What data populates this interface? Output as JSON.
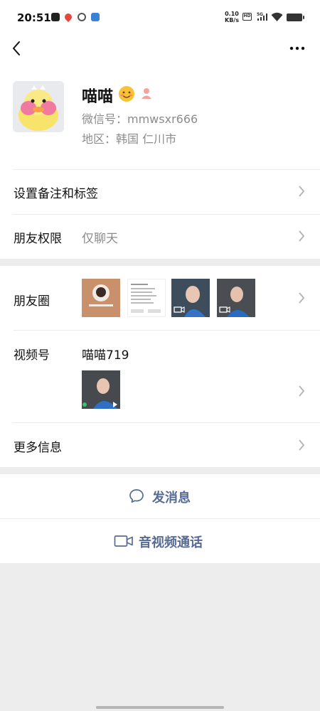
{
  "status_bar": {
    "time": "20:51",
    "net_speed_value": "0.10",
    "net_speed_unit": "KB/s",
    "hd": "HD",
    "signal": "5G"
  },
  "nav": {
    "back_icon": "chevron-left-icon",
    "more_icon": "more-dots-icon"
  },
  "profile": {
    "name": "喵喵",
    "wechat_id": "微信号：mmwsxr666",
    "region": "地区：韩国  仁川市"
  },
  "rows": {
    "remark": {
      "label": "设置备注和标签"
    },
    "permission": {
      "label": "朋友权限",
      "value": "仅聊天"
    },
    "moments": {
      "label": "朋友圈",
      "thumbs": 4
    },
    "channels": {
      "label": "视频号",
      "name": "喵喵719"
    },
    "more_info": {
      "label": "更多信息"
    }
  },
  "actions": {
    "message": "发消息",
    "call": "音视频通话"
  },
  "colors": {
    "accent": "#576b95",
    "background": "#ededed",
    "secondary_text": "#8c8c8c"
  }
}
